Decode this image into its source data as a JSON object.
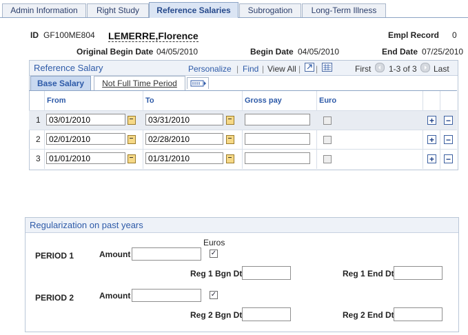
{
  "tabs": [
    {
      "label": "Admin Information"
    },
    {
      "label": "Right Study"
    },
    {
      "label": "Reference Salaries"
    },
    {
      "label": "Subrogation"
    },
    {
      "label": "Long-Term Illness"
    }
  ],
  "header": {
    "id_label": "ID",
    "id_value": "GF100ME804",
    "name": "LEMERRE,Florence",
    "empl_record_label": "Empl Record",
    "empl_record_value": "0",
    "orig_begin_label": "Original Begin Date",
    "orig_begin_value": "04/05/2010",
    "begin_label": "Begin Date",
    "begin_value": "04/05/2010",
    "end_label": "End Date",
    "end_value": "07/25/2010"
  },
  "reference_salary": {
    "title": "Reference Salary",
    "personalize": "Personalize",
    "find": "Find",
    "view_all": "View All",
    "first": "First",
    "range": "1-3 of 3",
    "last": "Last",
    "sep": "|",
    "subtabs": [
      {
        "label": "Base Salary",
        "active": true
      },
      {
        "label": "Not Full Time Period",
        "active": false
      }
    ],
    "columns": {
      "from": "From",
      "to": "To",
      "gross": "Gross pay",
      "euro": "Euro"
    },
    "rows": [
      {
        "num": "1",
        "from": "03/01/2010",
        "to": "03/31/2010",
        "gross": "",
        "euro": false
      },
      {
        "num": "2",
        "from": "02/01/2010",
        "to": "02/28/2010",
        "gross": "",
        "euro": false
      },
      {
        "num": "3",
        "from": "01/01/2010",
        "to": "01/31/2010",
        "gross": "",
        "euro": false
      }
    ]
  },
  "regularization": {
    "title": "Regularization on past years",
    "euros_label": "Euros",
    "periods": [
      {
        "label": "PERIOD 1",
        "amount_label": "Amount",
        "amount": "",
        "euro_checked": true,
        "bgn_label": "Reg 1 Bgn Dt",
        "bgn": "",
        "end_label": "Reg 1 End Dt",
        "end": ""
      },
      {
        "label": "PERIOD 2",
        "amount_label": "Amount",
        "amount": "",
        "euro_checked": true,
        "bgn_label": "Reg 2 Bgn Dt",
        "bgn": "",
        "end_label": "Reg 2 End Dt",
        "end": ""
      }
    ]
  },
  "colors": {
    "accent": "#2d5aa8",
    "tab_active_bg": "#dbe5f4",
    "group_head_bg": "#eef2f8"
  }
}
